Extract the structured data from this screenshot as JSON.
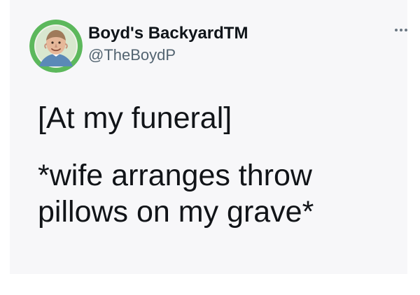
{
  "author": {
    "display_name": "Boyd's BackyardTM",
    "handle": "@TheBoydP",
    "avatar_icon": "avatar-icon",
    "avatar_ring_color": "#5cb85c"
  },
  "tweet": {
    "lines": [
      "[At my funeral]",
      "*wife arranges throw",
      "pillows on my grave*"
    ]
  },
  "more_icon": "more-horizontal-icon"
}
